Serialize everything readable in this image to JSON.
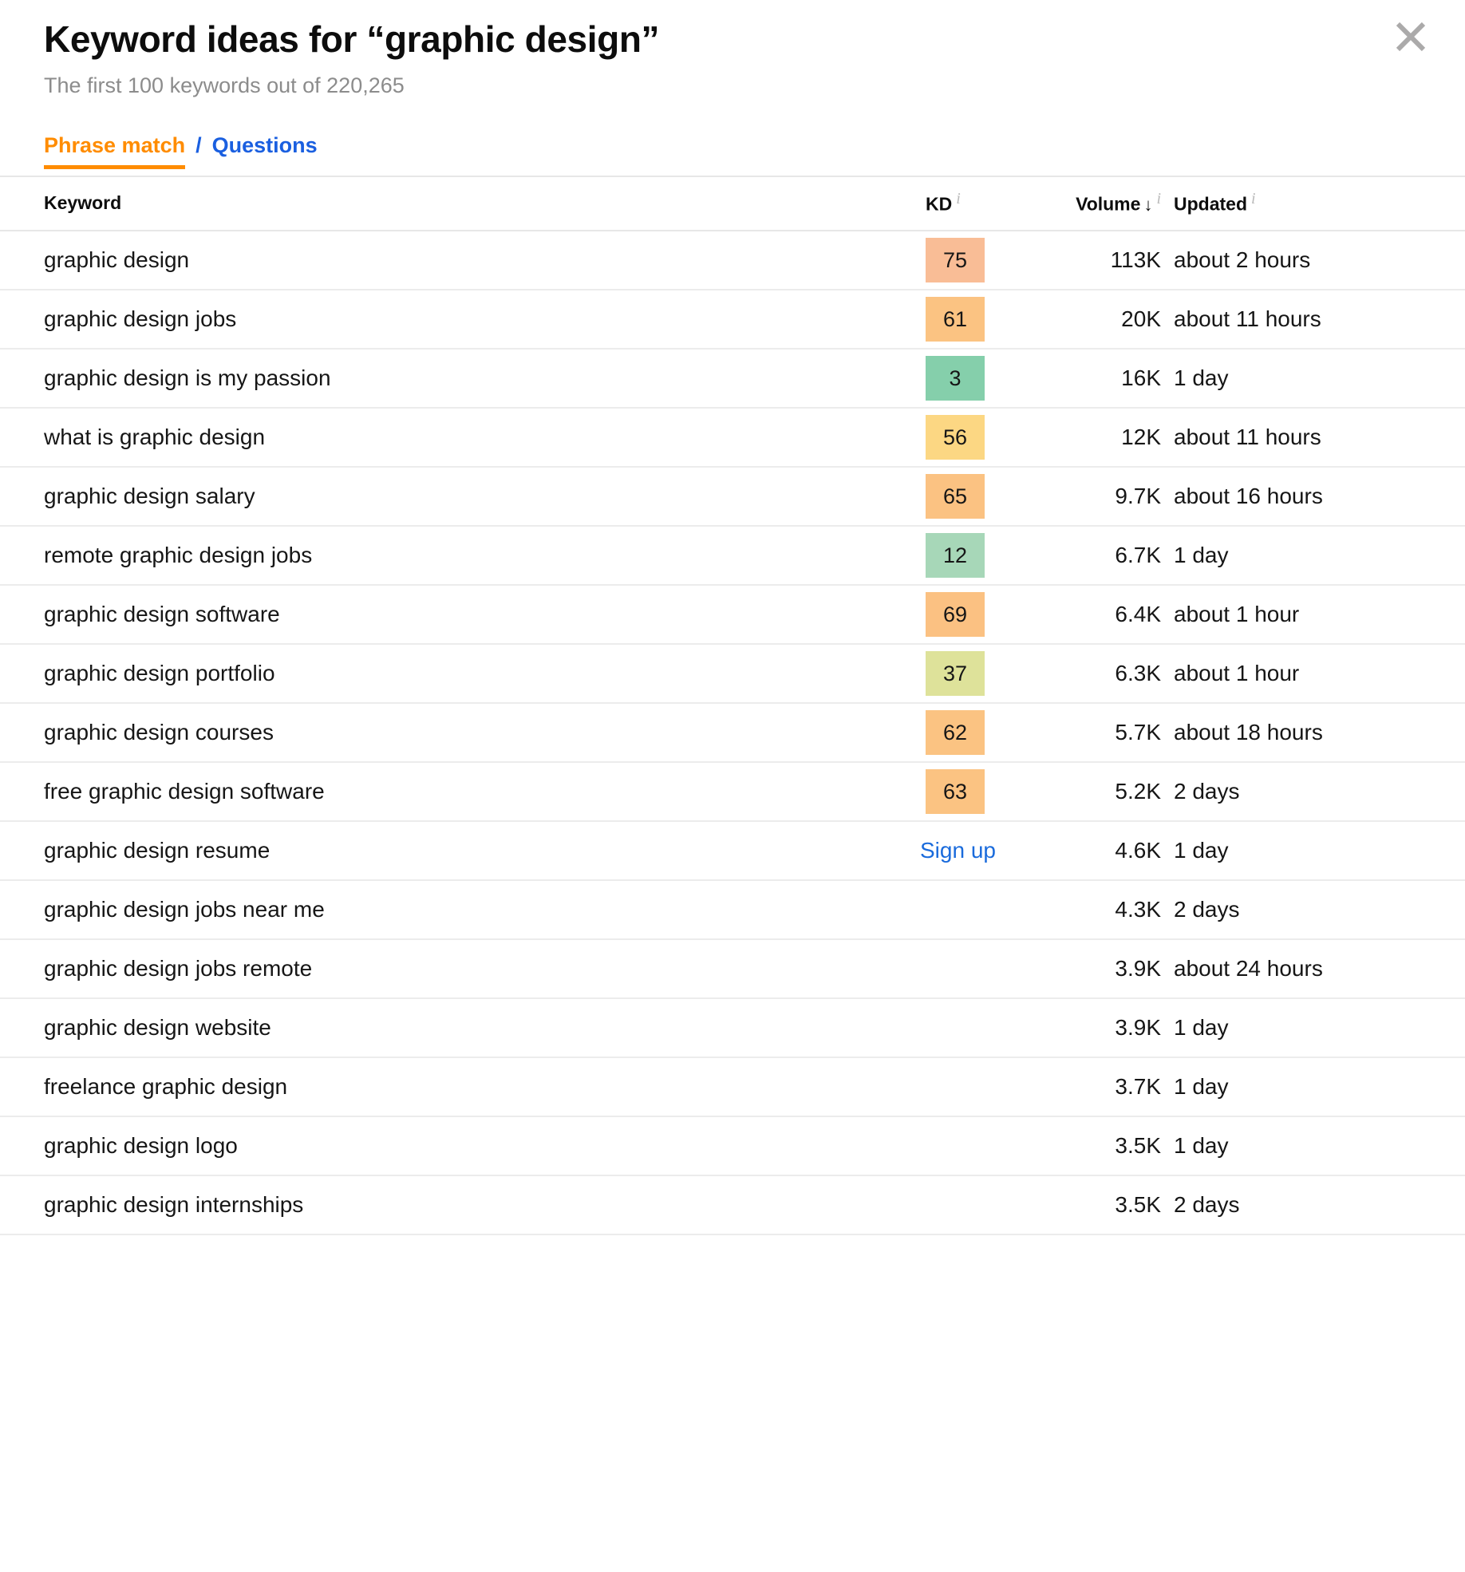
{
  "header": {
    "title": "Keyword ideas for “graphic design”",
    "subtitle": "The first 100 keywords out of 220,265",
    "close_icon": "close-icon"
  },
  "tabs": {
    "active_label": "Phrase match",
    "separator": "/",
    "link_label": "Questions",
    "active_color": "#ff8c00",
    "link_color": "#1a5fe0"
  },
  "table": {
    "columns": {
      "keyword": "Keyword",
      "kd": "KD",
      "volume": "Volume",
      "volume_sort_arrow": "↓",
      "updated": "Updated",
      "info_glyph": "i"
    },
    "signup_label": "Sign up",
    "rows": [
      {
        "keyword": "graphic design",
        "kd": "75",
        "kd_color": "#f9bd96",
        "volume": "113K",
        "updated": "about 2 hours"
      },
      {
        "keyword": "graphic design jobs",
        "kd": "61",
        "kd_color": "#fbc382",
        "volume": "20K",
        "updated": "about 11 hours"
      },
      {
        "keyword": "graphic design is my passion",
        "kd": "3",
        "kd_color": "#85cfab",
        "volume": "16K",
        "updated": "1 day"
      },
      {
        "keyword": "what is graphic design",
        "kd": "56",
        "kd_color": "#fcd783",
        "volume": "12K",
        "updated": "about 11 hours"
      },
      {
        "keyword": "graphic design salary",
        "kd": "65",
        "kd_color": "#fbc282",
        "volume": "9.7K",
        "updated": "about 16 hours"
      },
      {
        "keyword": "remote graphic design jobs",
        "kd": "12",
        "kd_color": "#a7d7b8",
        "volume": "6.7K",
        "updated": "1 day"
      },
      {
        "keyword": "graphic design software",
        "kd": "69",
        "kd_color": "#fbc182",
        "volume": "6.4K",
        "updated": "about 1 hour"
      },
      {
        "keyword": "graphic design portfolio",
        "kd": "37",
        "kd_color": "#dee29a",
        "volume": "6.3K",
        "updated": "about 1 hour"
      },
      {
        "keyword": "graphic design courses",
        "kd": "62",
        "kd_color": "#fbc382",
        "volume": "5.7K",
        "updated": "about 18 hours"
      },
      {
        "keyword": "free graphic design software",
        "kd": "63",
        "kd_color": "#fbc382",
        "volume": "5.2K",
        "updated": "2 days"
      },
      {
        "keyword": "graphic design resume",
        "kd": "",
        "kd_color": "",
        "kd_signup": true,
        "volume": "4.6K",
        "updated": "1 day"
      },
      {
        "keyword": "graphic design jobs near me",
        "kd": "",
        "kd_color": "",
        "volume": "4.3K",
        "updated": "2 days"
      },
      {
        "keyword": "graphic design jobs remote",
        "kd": "",
        "kd_color": "",
        "volume": "3.9K",
        "updated": "about 24 hours"
      },
      {
        "keyword": "graphic design website",
        "kd": "",
        "kd_color": "",
        "volume": "3.9K",
        "updated": "1 day"
      },
      {
        "keyword": "freelance graphic design",
        "kd": "",
        "kd_color": "",
        "volume": "3.7K",
        "updated": "1 day"
      },
      {
        "keyword": "graphic design logo",
        "kd": "",
        "kd_color": "",
        "volume": "3.5K",
        "updated": "1 day"
      },
      {
        "keyword": "graphic design internships",
        "kd": "",
        "kd_color": "",
        "volume": "3.5K",
        "updated": "2 days"
      }
    ]
  }
}
